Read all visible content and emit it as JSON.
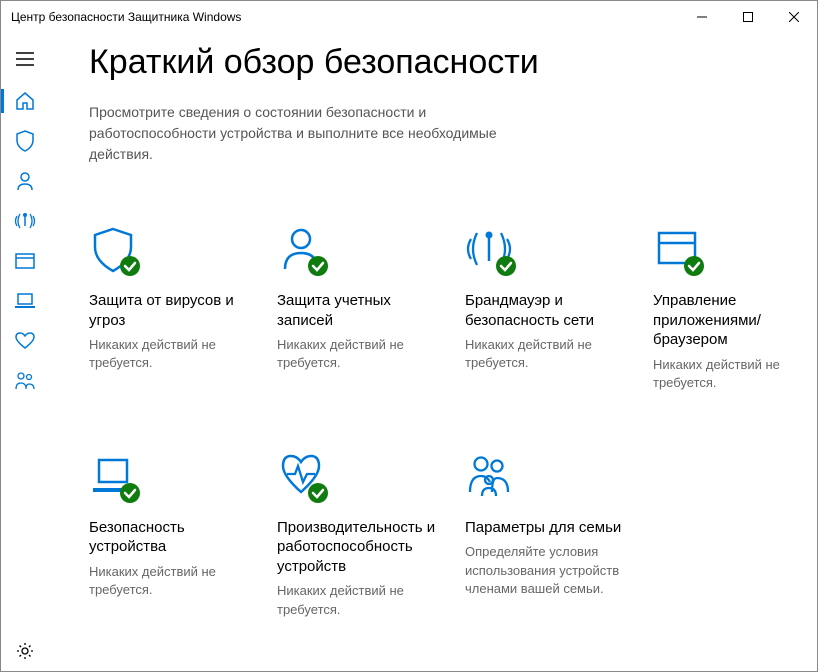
{
  "window": {
    "title": "Центр безопасности Защитника Windows"
  },
  "main": {
    "title": "Краткий обзор безопасности",
    "subtitle": "Просмотрите сведения о состоянии безопасности и работоспособности устройства и выполните все необходимые действия."
  },
  "cards": [
    {
      "title": "Защита от вирусов и угроз",
      "status": "Никаких действий не требуется."
    },
    {
      "title": "Защита учетных записей",
      "status": "Никаких действий не требуется."
    },
    {
      "title": "Брандмауэр и безопасность сети",
      "status": "Никаких действий не требуется."
    },
    {
      "title": "Управление приложениями/браузером",
      "status": "Никаких действий не требуется."
    },
    {
      "title": "Безопасность устройства",
      "status": "Никаких действий не требуется."
    },
    {
      "title": "Производительность и работоспособность устройств",
      "status": "Никаких действий не требуется."
    },
    {
      "title": "Параметры для семьи",
      "status": "Определяйте условия использования устройств членами вашей семьи."
    }
  ]
}
